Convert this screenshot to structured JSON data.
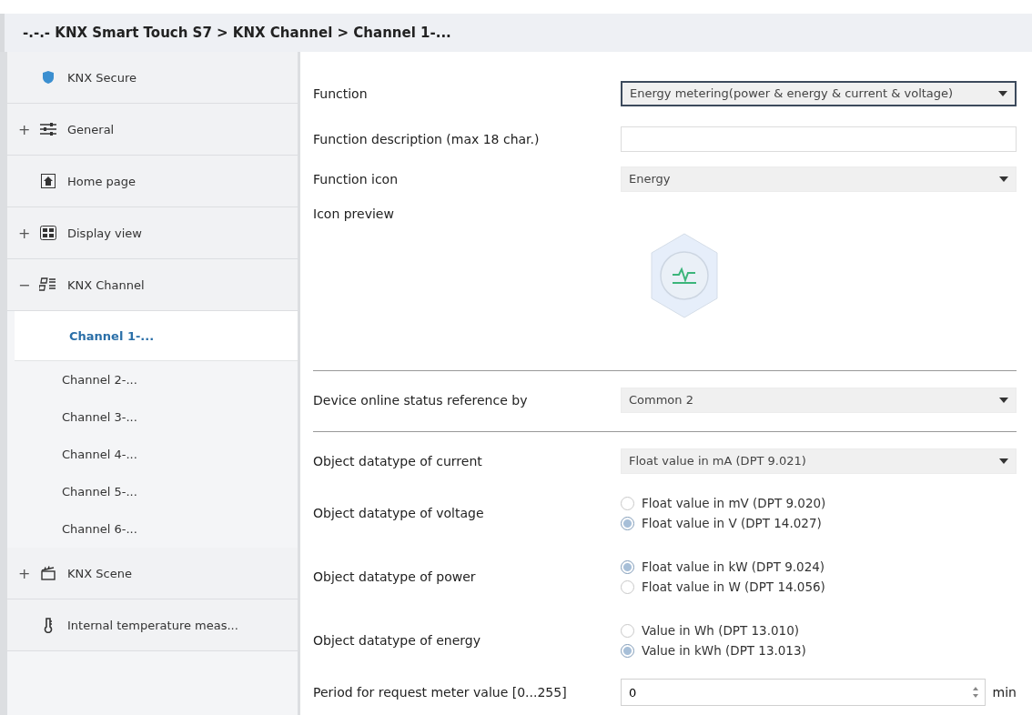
{
  "breadcrumb": "-.-.- KNX Smart Touch S7 > KNX Channel  > Channel 1-...",
  "sidebar": {
    "items": [
      {
        "label": "KNX Secure"
      },
      {
        "label": "General",
        "toggle": "+"
      },
      {
        "label": "Home page"
      },
      {
        "label": "Display view",
        "toggle": "+"
      },
      {
        "label": "KNX Channel",
        "toggle": "−",
        "children": [
          {
            "label": "Channel 1-...",
            "selected": true
          },
          {
            "label": "Channel 2-...",
            "selected": false
          },
          {
            "label": "Channel 3-...",
            "selected": false
          },
          {
            "label": "Channel 4-...",
            "selected": false
          },
          {
            "label": "Channel 5-...",
            "selected": false
          },
          {
            "label": "Channel 6-...",
            "selected": false
          }
        ]
      },
      {
        "label": "KNX Scene",
        "toggle": "+"
      },
      {
        "label": "Internal temperature meas..."
      }
    ]
  },
  "parameters": [
    {
      "kind": "dropdown",
      "label": "Function",
      "value": "Energy metering(power & energy & current & voltage)",
      "focused": true
    },
    {
      "kind": "text",
      "label": "Function description (max 18 char.)"
    },
    {
      "kind": "dropdown",
      "label": "Function icon",
      "value": "Energy",
      "focused": false
    },
    {
      "kind": "preview",
      "label": "Icon preview"
    },
    {
      "kind": "separator"
    },
    {
      "kind": "dropdown",
      "label": "Device online status reference by",
      "value": "Common 2",
      "focused": false
    },
    {
      "kind": "separator"
    },
    {
      "kind": "dropdown",
      "label": "Object datatype of current",
      "value": "Float value in mA (DPT 9.021)",
      "focused": false
    },
    {
      "kind": "radio",
      "label": "Object datatype of voltage",
      "options": [
        {
          "label": "Float value in mV (DPT 9.020)",
          "selected": false
        },
        {
          "label": "Float value in V (DPT 14.027)",
          "selected": true
        }
      ]
    },
    {
      "kind": "radio",
      "label": "Object datatype of power",
      "options": [
        {
          "label": "Float value in kW (DPT 9.024)",
          "selected": true
        },
        {
          "label": "Float value in W (DPT 14.056)",
          "selected": false
        }
      ]
    },
    {
      "kind": "radio",
      "label": "Object datatype of energy",
      "options": [
        {
          "label": "Value in Wh (DPT 13.010)",
          "selected": false
        },
        {
          "label": "Value in kWh (DPT 13.013)",
          "selected": true
        }
      ]
    },
    {
      "kind": "spin",
      "label": "Period for request meter value [0...255]",
      "value": "0",
      "unit": "min"
    }
  ]
}
